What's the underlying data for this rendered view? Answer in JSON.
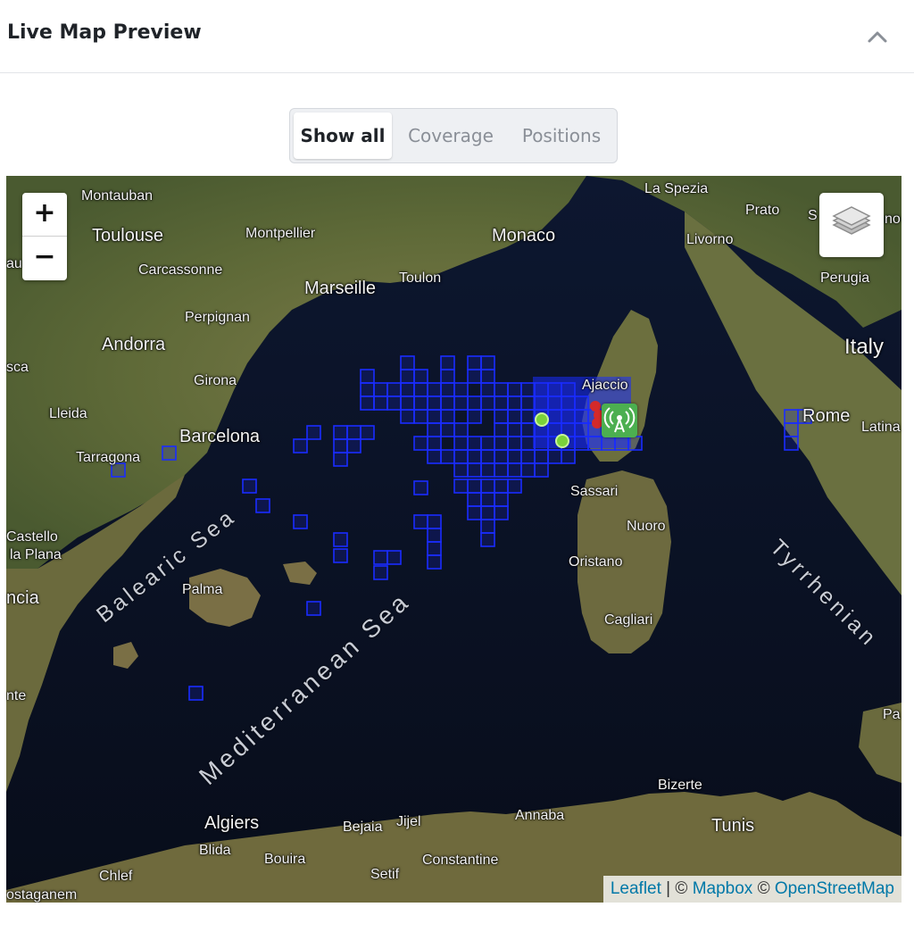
{
  "panel": {
    "title": "Live Map Preview",
    "collapse_icon": "chevron-up-icon"
  },
  "segmented": {
    "items": [
      {
        "label": "Show all",
        "active": true
      },
      {
        "label": "Coverage",
        "active": false
      },
      {
        "label": "Positions",
        "active": false
      }
    ]
  },
  "map": {
    "zoom_in_label": "+",
    "zoom_out_label": "−",
    "layers_icon": "layers-icon",
    "gateway_icon": "antenna-icon",
    "coverage_color": "#1a2cff",
    "attribution": {
      "leaflet": "Leaflet",
      "sep": " | © ",
      "mapbox": "Mapbox",
      "sep2": " © ",
      "osm": "OpenStreetMap"
    },
    "labels": {
      "montauban": "Montauban",
      "toulouse": "Toulouse",
      "montpellier": "Montpellier",
      "monaco": "Monaco",
      "la_spezia": "La Spezia",
      "prato": "Prato",
      "livorno": "Livorno",
      "carcassonne": "Carcassonne",
      "marseille": "Marseille",
      "toulon": "Toulon",
      "perugia": "Perugia",
      "perpignan": "Perpignan",
      "andorra": "Andorra",
      "italy": "Italy",
      "girona": "Girona",
      "ajaccio": "Ajaccio",
      "lleida": "Lleida",
      "barcelona": "Barcelona",
      "rome": "Rome",
      "latina": "Latina",
      "tarragona": "Tarragona",
      "sassari": "Sassari",
      "nuoro": "Nuoro",
      "castello": "Castello",
      "la_plana": "la Plana",
      "oristano": "Oristano",
      "palma": "Palma",
      "cagliari": "Cagliari",
      "bizerte": "Bizerte",
      "tunis": "Tunis",
      "algiers": "Algiers",
      "bejaia": "Bejaia",
      "jijel": "Jijel",
      "annaba": "Annaba",
      "blida": "Blida",
      "bouira": "Bouira",
      "constantine": "Constantine",
      "chlef": "Chlef",
      "setif": "Setif",
      "mostaganem": "ostaganem",
      "sca": "sca",
      "au": "au",
      "ncia": "ncia",
      "nte": "nte",
      "pa": "Pa",
      "s_edge": "S",
      "no_edge": "no",
      "balearic_sea": "Balearic Sea",
      "mediterranean_sea": "Mediterranean Sea",
      "tyrrhenian": "Tyrrhenian"
    }
  }
}
